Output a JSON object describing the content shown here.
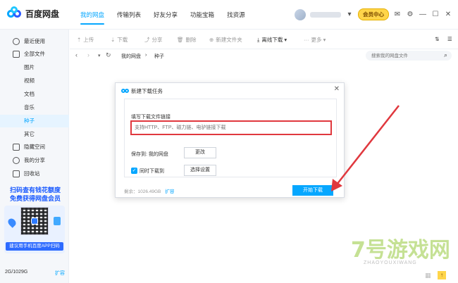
{
  "app": {
    "name": "百度网盘"
  },
  "nav": [
    "我的网盘",
    "传输列表",
    "好友分享",
    "功能宝箱",
    "找资源"
  ],
  "header": {
    "vip_label": "会员中心"
  },
  "sidebar": {
    "items": [
      "最近使用",
      "全部文件",
      "图片",
      "视频",
      "文档",
      "音乐",
      "种子",
      "其它",
      "隐藏空间",
      "我的分享",
      "回收站"
    ],
    "promo_line1": "扫码查有钱花额度",
    "promo_line2": "免费获得网盘会员",
    "promo_button": "建议用手机百度APP扫码",
    "storage": "2G/1029G",
    "expand": "扩容"
  },
  "toolbar": {
    "upload": "上传",
    "download": "下载",
    "share": "分享",
    "delete": "删除",
    "new_folder": "新建文件夹",
    "offline_download": "离线下载",
    "more": "更多"
  },
  "breadcrumb": {
    "root": "我的网盘",
    "current": "种子"
  },
  "search": {
    "placeholder": "搜索我的网盘文件"
  },
  "dialog": {
    "title": "新建下载任务",
    "field_label": "填写下载文件链接",
    "url_placeholder": "支持HTTP、FTP、磁力链、电驴链接下载",
    "save_to": "保存到: 我的网盘",
    "change_button": "更改",
    "sync_label": "同时下载到",
    "settings_button": "选择设置",
    "remaining": "剩余：1026.49GB",
    "expand": "扩容",
    "start_button": "开始下载"
  },
  "watermark": {
    "main": "7号游戏网",
    "sub": "ZHAOYOUXIWANG"
  },
  "colors": {
    "accent": "#06a7ff",
    "annotation": "#e0383e",
    "vip": "#ffd54a"
  }
}
